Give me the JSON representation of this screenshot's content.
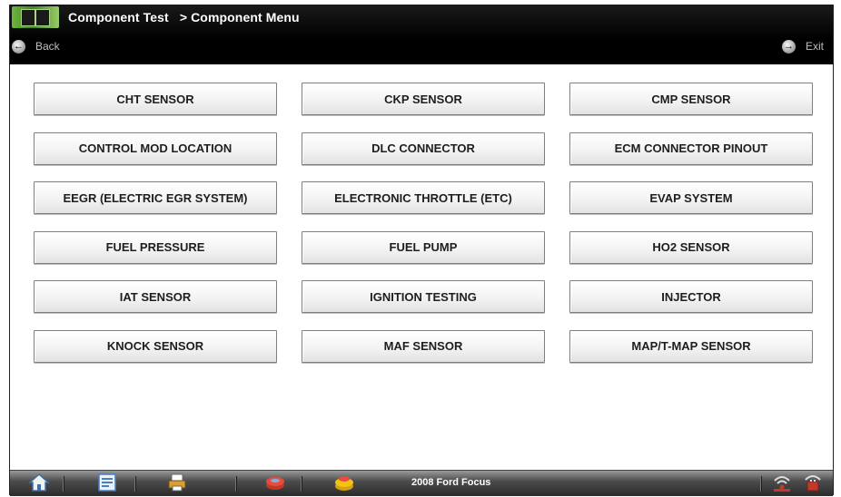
{
  "header": {
    "title": "Component Test",
    "breadcrumb": "> Component Menu",
    "back_label": "Back",
    "exit_label": "Exit"
  },
  "components": [
    "CHT SENSOR",
    "CKP SENSOR",
    "CMP SENSOR",
    "CONTROL MOD LOCATION",
    "DLC CONNECTOR",
    "ECM CONNECTOR PINOUT",
    "EEGR (ELECTRIC EGR SYSTEM)",
    "ELECTRONIC THROTTLE (ETC)",
    "EVAP SYSTEM",
    "FUEL PRESSURE",
    "FUEL PUMP",
    "HO2 SENSOR",
    "IAT SENSOR",
    "IGNITION TESTING",
    "INJECTOR",
    "KNOCK SENSOR",
    "MAF SENSOR",
    "MAP/T-MAP SENSOR"
  ],
  "taskbar": {
    "vehicle": "2008 Ford Focus",
    "icons": [
      "home-icon",
      "vehicle-info-icon",
      "print-icon",
      "scanner-icon",
      "data-icon",
      "connection-icon",
      "battery-icon"
    ]
  },
  "colors": {
    "header_bg": "#000000",
    "button_text": "#1e1e1e",
    "app_icon_green": "#6db33f"
  }
}
